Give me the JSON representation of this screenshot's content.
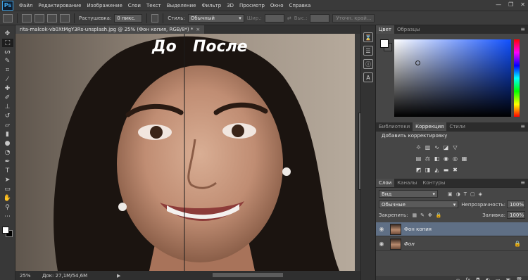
{
  "app": {
    "logo": "Ps"
  },
  "menu": [
    "Файл",
    "Редактирование",
    "Изображение",
    "Слои",
    "Текст",
    "Выделение",
    "Фильтр",
    "3D",
    "Просмотр",
    "Окно",
    "Справка"
  ],
  "window_controls": {
    "minimize": "—",
    "restore": "❐",
    "close": "✕"
  },
  "options": {
    "feather_label": "Растушевка:",
    "feather_value": "0 пикс.",
    "style_label": "Стиль:",
    "style_value": "Обычный",
    "width_label": "Шир.:",
    "height_label": "Выс.:",
    "refine_button": "Уточн. край..."
  },
  "document": {
    "tab_title": "rita-malcok-vb0XtMgY3Rs-unsplash.jpg @ 25% (Фон копия, RGB/8*) *",
    "close": "×",
    "label_before": "До",
    "label_after": "После"
  },
  "status": {
    "zoom": "25%",
    "doc": "Док: 27,1M/54,6M",
    "arrow": "▶"
  },
  "panels": {
    "color_tabs": [
      "Цвет",
      "Образцы"
    ],
    "adjust_tabs": [
      "Библиотеки",
      "Коррекция",
      "Стили"
    ],
    "adjust_title": "Добавить корректировку",
    "layers_tabs": [
      "Слои",
      "Каналы",
      "Контуры"
    ],
    "filter_kind": "Вид",
    "blend_mode": "Обычные",
    "opacity_label": "Непрозрачность:",
    "opacity_value": "100%",
    "lock_label": "Закрепить:",
    "fill_label": "Заливка:",
    "fill_value": "100%",
    "layers": [
      {
        "name": "Фон копия",
        "selected": true
      },
      {
        "name": "Фон",
        "selected": false
      }
    ],
    "footer_icons": [
      "∞",
      "fx",
      "◘",
      "◐",
      "▭",
      "▣",
      "🗑"
    ]
  },
  "colors": {
    "accent": "#1050ff",
    "selected_layer": "#5f6f85"
  }
}
